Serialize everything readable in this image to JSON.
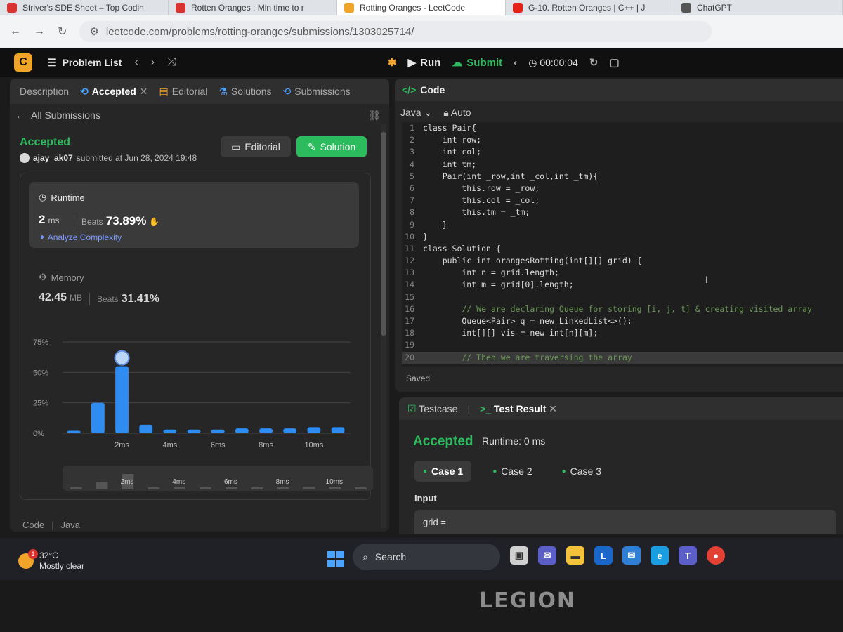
{
  "browser": {
    "tabs": [
      {
        "label": "Striver's SDE Sheet – Top Codin",
        "favicon_color": "#d9332f"
      },
      {
        "label": "Rotten Oranges : Min time to r",
        "favicon_color": "#d9332f"
      },
      {
        "label": "Rotting Oranges - LeetCode",
        "favicon_color": "#f0a429"
      },
      {
        "label": "G-10. Rotten Oranges | C++ | J",
        "favicon_color": "#e62117"
      },
      {
        "label": "ChatGPT",
        "favicon_color": "#555555"
      }
    ],
    "active_tab": 2,
    "url": "leetcode.com/problems/rotting-oranges/submissions/1303025714/"
  },
  "header": {
    "problem_list": "Problem List",
    "run": "Run",
    "submit": "Submit",
    "timer": "00:00:04"
  },
  "left": {
    "tabs": [
      "Description",
      "Accepted",
      "Editorial",
      "Solutions",
      "Submissions"
    ],
    "all_submissions": "All Submissions",
    "status": "Accepted",
    "user": "ajay_ak07",
    "submitted": "submitted at Jun 28, 2024 19:48",
    "editorial_btn": "Editorial",
    "solution_btn": "Solution",
    "runtime": {
      "label": "Runtime",
      "value": "2",
      "unit": "ms",
      "beats_label": "Beats",
      "beats": "73.89%",
      "analyze": "Analyze Complexity"
    },
    "memory": {
      "label": "Memory",
      "value": "42.45",
      "unit": "MB",
      "beats_label": "Beats",
      "beats": "31.41%"
    },
    "footer": [
      "Code",
      "Java"
    ]
  },
  "chart_data": {
    "type": "bar",
    "y_ticks": [
      "75%",
      "50%",
      "25%",
      "0%"
    ],
    "x_labels": [
      "2ms",
      "4ms",
      "6ms",
      "8ms",
      "10ms"
    ],
    "values": [
      2,
      25,
      55,
      7,
      3,
      3,
      3,
      4,
      4,
      4,
      5,
      5
    ],
    "highlight_index": 2,
    "ylim": [
      0,
      75
    ]
  },
  "code_panel": {
    "title": "Code",
    "language": "Java",
    "mode": "Auto",
    "saved": "Saved",
    "lines": [
      "class Pair{",
      "    int row;",
      "    int col;",
      "    int tm;",
      "    Pair(int _row,int _col,int _tm){",
      "        this.row = _row;",
      "        this.col = _col;",
      "        this.tm = _tm;",
      "    }",
      "}",
      "class Solution {",
      "    public int orangesRotting(int[][] grid) {",
      "        int n = grid.length;",
      "        int m = grid[0].length;",
      "",
      "        // We are declaring Queue for storing [i, j, t] & creating visited array",
      "        Queue<Pair> q = new LinkedList<>();",
      "        int[][] vis = new int[n][m];",
      "",
      "        // Then we are traversing the array"
    ]
  },
  "test": {
    "tabs": [
      "Testcase",
      "Test Result"
    ],
    "status": "Accepted",
    "runtime": "Runtime: 0 ms",
    "cases": [
      "Case 1",
      "Case 2",
      "Case 3"
    ],
    "input_label": "Input",
    "input_value": "grid ="
  },
  "taskbar": {
    "temp": "32°C",
    "weather": "Mostly clear",
    "weather_badge": "1",
    "search": "Search"
  },
  "laptop_brand": "LEGION"
}
